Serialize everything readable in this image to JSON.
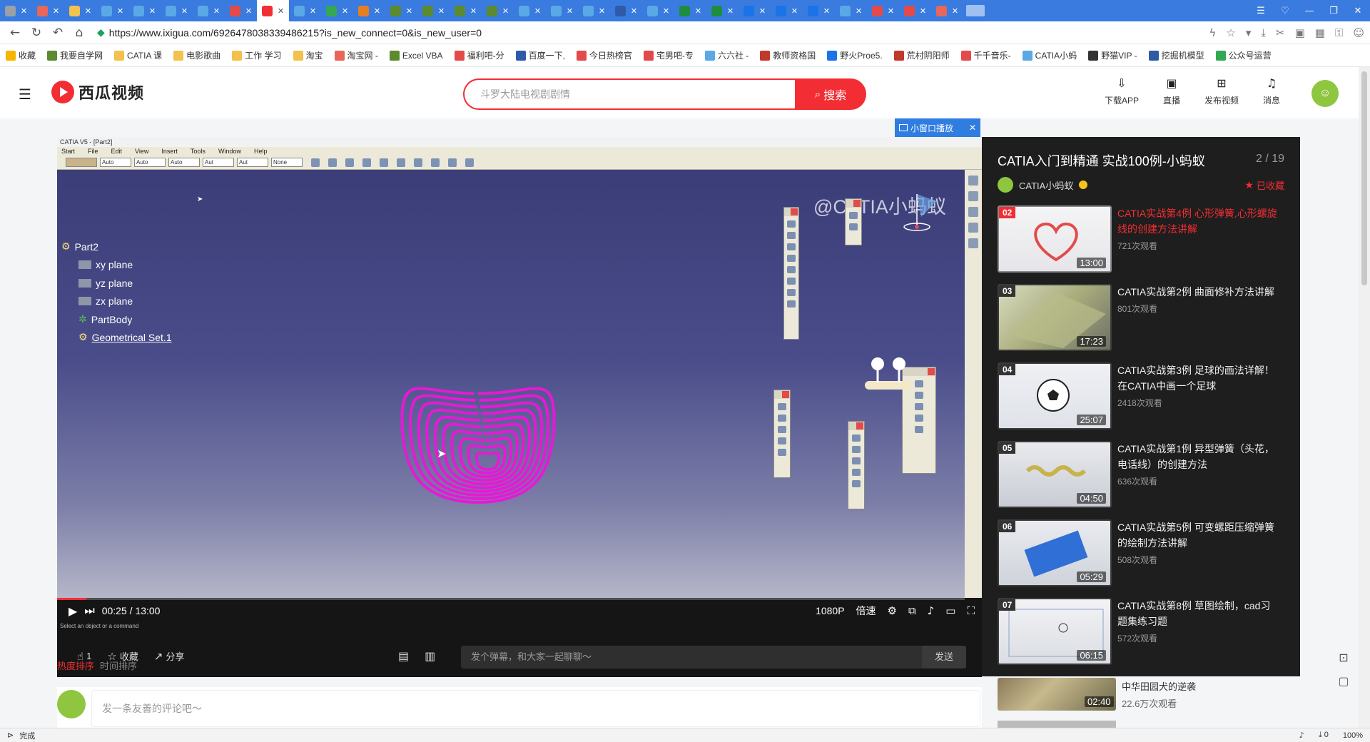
{
  "browser": {
    "tabs": [
      {
        "color": "#9aa0a6"
      },
      {
        "color": "#e8665a"
      },
      {
        "color": "#f2c14e"
      },
      {
        "color": "#5aa9e6"
      },
      {
        "color": "#5aa9e6"
      },
      {
        "color": "#5aa9e6"
      },
      {
        "color": "#5aa9e6"
      },
      {
        "color": "#e34a4a"
      },
      {
        "color": "#f22d33",
        "active": true
      },
      {
        "color": "#5aa9e6"
      },
      {
        "color": "#34a853"
      },
      {
        "color": "#e67e22"
      },
      {
        "color": "#5c8a2e"
      },
      {
        "color": "#5c8a2e"
      },
      {
        "color": "#5c8a2e"
      },
      {
        "color": "#5c8a2e"
      },
      {
        "color": "#5aa9e6"
      },
      {
        "color": "#5aa9e6"
      },
      {
        "color": "#5aa9e6"
      },
      {
        "color": "#2e5aa8"
      },
      {
        "color": "#5aa9e6"
      },
      {
        "color": "#1e8e3e"
      },
      {
        "color": "#1e8e3e"
      },
      {
        "color": "#1a73e8"
      },
      {
        "color": "#1a73e8"
      },
      {
        "color": "#1a73e8"
      },
      {
        "color": "#5aa9e6"
      },
      {
        "color": "#e34a4a"
      },
      {
        "color": "#e34a4a"
      },
      {
        "color": "#e8665a"
      }
    ],
    "url": "https://www.ixigua.com/6926478038339486215?is_new_connect=0&is_new_user=0",
    "bookmarks": [
      {
        "label": "收藏",
        "color": "#f6b500"
      },
      {
        "label": "我要自学网",
        "color": "#5c8a2e"
      },
      {
        "label": "CATIA 课",
        "color": "#f2c14e"
      },
      {
        "label": "电影歌曲",
        "color": "#f2c14e"
      },
      {
        "label": "工作 学习",
        "color": "#f2c14e"
      },
      {
        "label": "淘宝",
        "color": "#f2c14e"
      },
      {
        "label": "淘宝网 -",
        "color": "#e8665a"
      },
      {
        "label": "Excel VBA",
        "color": "#5c8a2e"
      },
      {
        "label": "福利吧-分",
        "color": "#e34a4a"
      },
      {
        "label": "百度一下,",
        "color": "#2e5aa8"
      },
      {
        "label": "今日热榜官",
        "color": "#e34a4a"
      },
      {
        "label": "宅男吧-专",
        "color": "#e34a4a"
      },
      {
        "label": "六六社 -",
        "color": "#5aa9e6"
      },
      {
        "label": "教师资格国",
        "color": "#c0392b"
      },
      {
        "label": "野火Proe5.",
        "color": "#1a73e8"
      },
      {
        "label": "荒村阴阳师",
        "color": "#c0392b"
      },
      {
        "label": "千千音乐-",
        "color": "#e34a4a"
      },
      {
        "label": "CATIA小蚂",
        "color": "#5aa9e6"
      },
      {
        "label": "野猫VIP -",
        "color": "#333333"
      },
      {
        "label": "挖掘机模型",
        "color": "#2e5aa8"
      },
      {
        "label": "公众号运营",
        "color": "#34a853"
      }
    ]
  },
  "header": {
    "logo": "西瓜视频",
    "search_placeholder": "斗罗大陆电视剧剧情",
    "search_button": "搜索",
    "actions": [
      {
        "icon": "download-app-icon",
        "glyph": "⇩",
        "label": "下载APP"
      },
      {
        "icon": "live-icon",
        "glyph": "▣",
        "label": "直播"
      },
      {
        "icon": "publish-video-icon",
        "glyph": "⊞",
        "label": "发布视频"
      },
      {
        "icon": "bell-icon",
        "glyph": "♫",
        "label": "消息"
      }
    ]
  },
  "player": {
    "mini_window": "小窗口播放",
    "catia": {
      "title": "CATIA V5 - [Part2]",
      "menu": [
        "Start",
        "File",
        "Edit",
        "View",
        "Insert",
        "Tools",
        "Window",
        "Help"
      ],
      "toolbar_selects": [
        "",
        "Auto",
        "Auto",
        "Auto",
        "Aut",
        "Aut",
        "None"
      ],
      "tree": {
        "root": "Part2",
        "children": [
          "xy plane",
          "yz plane",
          "zx plane",
          "PartBody",
          "Geometrical Set.1"
        ]
      },
      "status_text": "Select an object or a command"
    },
    "watermark": "@CATIA小蚂蚁",
    "time_current": "00:25",
    "time_total": "13:00",
    "time_separator": " / ",
    "progress": 0.032,
    "quality": "1080P",
    "speed": "倍速"
  },
  "actions_bar": {
    "like_count": "1",
    "favorite": "收藏",
    "share": "分享",
    "sort_hot": "热度排序",
    "sort_time": "时间排序",
    "danmaku_placeholder": "发个弹幕，和大家一起聊聊～",
    "send": "发送"
  },
  "comment": {
    "placeholder": "发一条友善的评论吧～"
  },
  "playlist": {
    "title": "CATIA入门到精通 实战100例-小蚂蚁",
    "count": "2 / 19",
    "author": "CATIA小蚂蚁",
    "favorited": "已收藏",
    "items": [
      {
        "index": "02",
        "title": "CATIA实战第4例 心形弹簧,心形螺旋线的创建方法讲解",
        "views": "721次观看",
        "duration": "13:00",
        "current": true,
        "thumb": "heart"
      },
      {
        "index": "03",
        "title": "CATIA实战第2例 曲面修补方法讲解",
        "views": "801次观看",
        "duration": "17:23",
        "thumb": "surface"
      },
      {
        "index": "04",
        "title": "CATIA实战第3例 足球的画法详解！在CATIA中画一个足球",
        "views": "2418次观看",
        "duration": "25:07",
        "thumb": "ball"
      },
      {
        "index": "05",
        "title": "CATIA实战第1例 异型弹簧（头花，电话线）的创建方法",
        "views": "636次观看",
        "duration": "04:50",
        "thumb": "spring"
      },
      {
        "index": "06",
        "title": "CATIA实战第5例 可变螺距压缩弹簧的绘制方法讲解",
        "views": "508次观看",
        "duration": "05:29",
        "thumb": "coil"
      },
      {
        "index": "07",
        "title": "CATIA实战第8例 草图绘制，cad习题集练习题",
        "views": "572次观看",
        "duration": "06:15",
        "thumb": "sketch"
      }
    ]
  },
  "recommend": {
    "title": "中华田园犬的逆袭",
    "views": "22.6万次观看",
    "duration": "02:40"
  },
  "statusbar": {
    "left": "完成",
    "zoom": "100%",
    "downloads": "0"
  }
}
